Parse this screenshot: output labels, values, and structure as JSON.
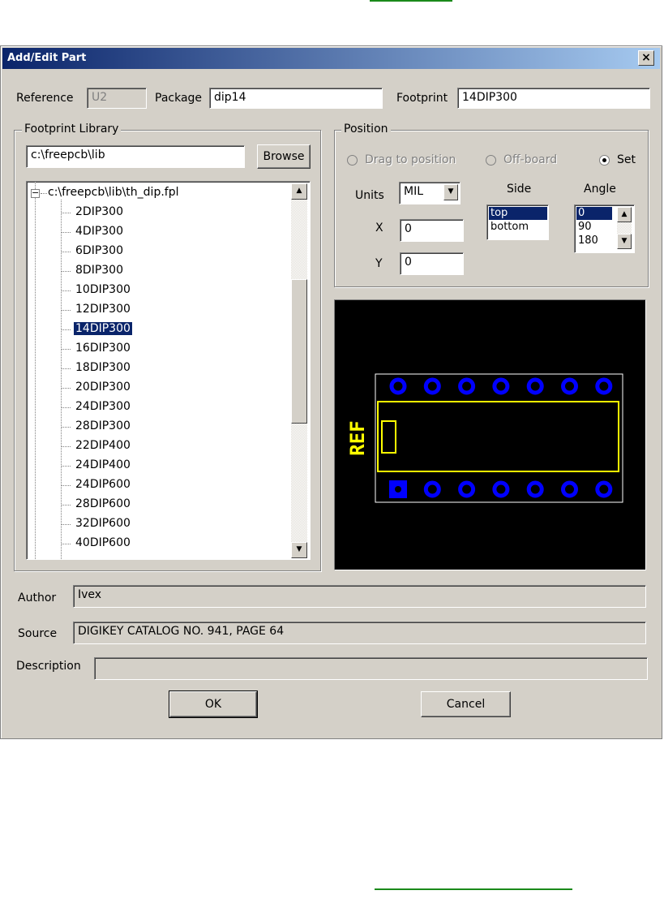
{
  "dialog": {
    "title": "Add/Edit Part",
    "close_glyph": "×"
  },
  "fields": {
    "reference_label": "Reference",
    "reference_value": "U2",
    "package_label": "Package",
    "package_value": "dip14",
    "footprint_label": "Footprint",
    "footprint_value": "14DIP300"
  },
  "library": {
    "group_title": "Footprint Library",
    "path_value": "c:\\freepcb\\lib",
    "browse_label": "Browse",
    "root_node": "c:\\freepcb\\lib\\th_dip.fpl",
    "expander_glyph": "−",
    "items": [
      "2DIP300",
      "4DIP300",
      "6DIP300",
      "8DIP300",
      "10DIP300",
      "12DIP300",
      "14DIP300",
      "16DIP300",
      "18DIP300",
      "20DIP300",
      "24DIP300",
      "28DIP300",
      "22DIP400",
      "24DIP400",
      "24DIP600",
      "28DIP600",
      "32DIP600",
      "40DIP600"
    ],
    "selected": "14DIP300",
    "scroll_position": 0.4
  },
  "position": {
    "group_title": "Position",
    "radio_drag": "Drag to position",
    "radio_offboard": "Off-board",
    "radio_set": "Set",
    "selected_radio": "Set",
    "units_label": "Units",
    "units_value": "MIL",
    "x_label": "X",
    "x_value": "0",
    "y_label": "Y",
    "y_value": "0",
    "side_label": "Side",
    "side_options": [
      "top",
      "bottom"
    ],
    "side_selected": "top",
    "angle_label": "Angle",
    "angle_options": [
      "0",
      "90",
      "180"
    ],
    "angle_selected": "0"
  },
  "preview": {
    "ref_text": "REF",
    "pin_color": "#0000ff",
    "outline_color": "#ffff00",
    "board_outline_color": "#ffffff",
    "background": "#000000",
    "pins_per_row": 7
  },
  "info": {
    "author_label": "Author",
    "author_value": "Ivex",
    "source_label": "Source",
    "source_value": "DIGIKEY CATALOG NO. 941, PAGE 64",
    "description_label": "Description",
    "description_value": ""
  },
  "buttons": {
    "ok": "OK",
    "cancel": "Cancel"
  },
  "icons": {
    "dropdown": "triangle-down",
    "scroll_up": "triangle-up",
    "scroll_down": "triangle-down"
  }
}
